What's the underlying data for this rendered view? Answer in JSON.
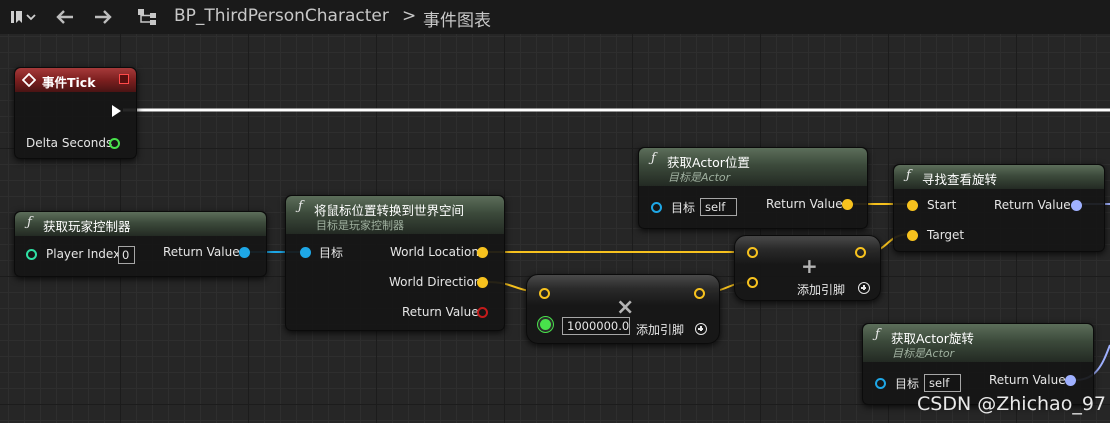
{
  "toolbar": {
    "breadcrumb": [
      "BP_ThirdPersonCharacter",
      "事件图表"
    ],
    "separator": ">"
  },
  "nodes": {
    "event_tick": {
      "title": "事件Tick",
      "output": "Delta Seconds"
    },
    "get_player_controller": {
      "title": "获取玩家控制器",
      "input": "Player Index",
      "input_value": "0",
      "output": "Return Value"
    },
    "convert_mouse": {
      "title": "将鼠标位置转换到世界空间",
      "subtitle": "目标是玩家控制器",
      "input": "目标",
      "outputs": [
        "World Location",
        "World Direction",
        "Return Value"
      ]
    },
    "get_actor_location": {
      "title": "获取Actor位置",
      "subtitle": "目标是Actor",
      "input": "目标",
      "input_value": "self",
      "output": "Return Value"
    },
    "find_look_at": {
      "title": "寻找查看旋转",
      "inputs": [
        "Start",
        "Target"
      ],
      "output": "Return Value"
    },
    "get_actor_rotation": {
      "title": "获取Actor旋转",
      "subtitle": "目标是Actor",
      "input": "目标",
      "input_value": "self",
      "output": "Return Value"
    },
    "multiply": {
      "symbol": "×",
      "input_value": "1000000.0",
      "add_pin": "添加引脚"
    },
    "add": {
      "symbol": "+",
      "add_pin": "添加引脚"
    }
  },
  "colors": {
    "vector_pin": "#f7c21e",
    "object_pin": "#1ea7e6",
    "float_pin": "#48e24b",
    "rotator_pin": "#9fb0ff",
    "event_header": "#8c2424",
    "function_header": "#4a5a49"
  },
  "watermark": "CSDN @Zhichao_97"
}
